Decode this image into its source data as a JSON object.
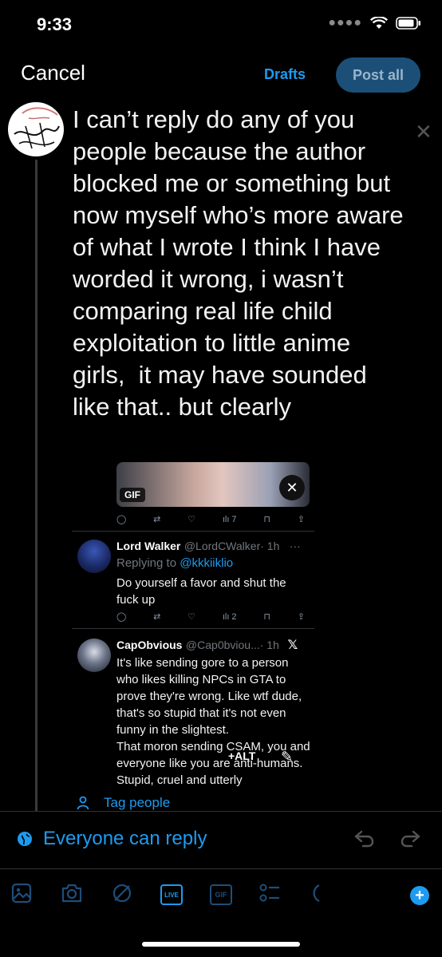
{
  "status_bar": {
    "time": "9:33"
  },
  "header": {
    "cancel_label": "Cancel",
    "drafts_label": "Drafts",
    "post_all_label": "Post all"
  },
  "composer": {
    "text": "I can’t reply do any of you people because the author blocked me or something but now myself who’s more aware of what I wrote I think I have worded it wrong, i wasn’t comparing real life child exploitation to little anime girls,  it may have sounded like that.. but clearly"
  },
  "embed": {
    "gif_badge": "GIF",
    "gif_views": "7",
    "tweet1": {
      "name": "Lord Walker",
      "handle": "@LordCWalker",
      "time": "· 1h",
      "more": "···",
      "replying_prefix": "Replying to",
      "replying_to": "@kkkiiklio",
      "body": "Do yourself a favor and shut the fuck up",
      "views": "2"
    },
    "tweet2": {
      "name": "CapObvious",
      "handle": "@Cap0bviou...",
      "time": "· 1h",
      "body": "It's like sending gore to a person who likes killing NPCs in GTA to prove they're wrong. Like wtf dude, that's so stupid that it's not even funny in the slightest.\nThat moron sending CSAM, you and everyone like you are anti-humans. Stupid, cruel and utterly"
    },
    "alt_label": "+ALT"
  },
  "tag_people_label": "Tag people",
  "reply_setting_label": "Everyone can reply",
  "toolbar": {
    "live_label": "LIVE",
    "gif_label": "GIF"
  },
  "colors": {
    "accent": "#1d9bf0",
    "post_all_bg": "#1b4f77",
    "background": "#000000"
  }
}
